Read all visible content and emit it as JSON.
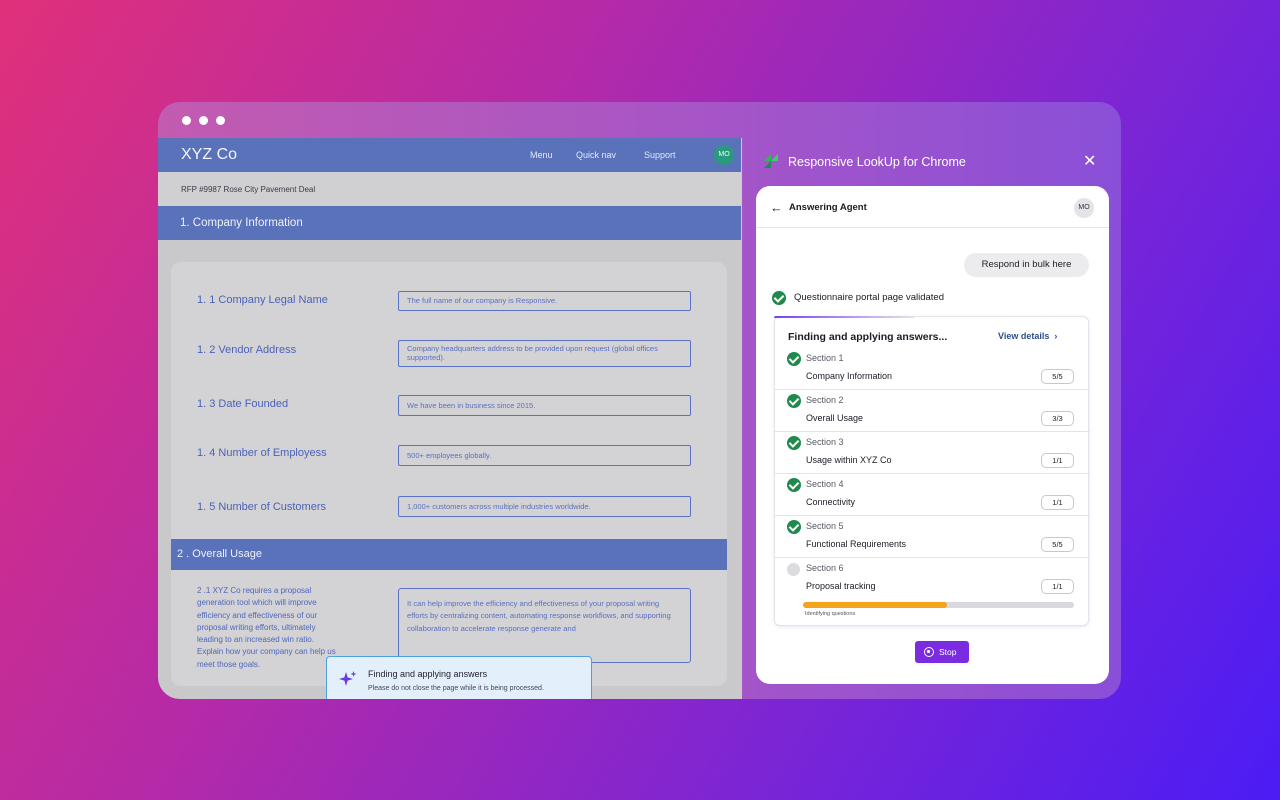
{
  "company": {
    "brand": "XYZ Co",
    "nav": [
      "Menu",
      "Quick nav",
      "Support"
    ],
    "avatar": "MO",
    "breadcrumb": "RFP #9987 Rose City Pavement Deal"
  },
  "section1": {
    "title": "1. Company Information",
    "fields": [
      {
        "label": "1. 1 Company Legal Name",
        "value": "The full name of our company is Responsive."
      },
      {
        "label": "1. 2 Vendor Address",
        "value": "Company headquarters address to be provided upon request (global offices supported)."
      },
      {
        "label": "1. 3 Date Founded",
        "value": "We have been in business since 2015."
      },
      {
        "label": "1. 4 Number of Employess",
        "value": "500+ employees globally."
      },
      {
        "label": "1. 5 Number of Customers",
        "value": "1,000+ customers across multiple industries worldwide."
      }
    ]
  },
  "section2": {
    "title": "2 . Overall Usage",
    "question": "2 .1 XYZ Co requires a proposal generation tool which will improve efficiency and effectiveness of our proposal writing efforts, ultimately leading to an increased win ratio. Explain how your company can help us meet those goals.",
    "answer": "It can help improve the efficiency and effectiveness of your proposal writing efforts by centralizing content, automating response workflows, and supporting collaboration to accelerate response generate and"
  },
  "toast": {
    "title": "Finding and applying answers",
    "subtitle": "Please do not close the page while it is being processed."
  },
  "extension": {
    "title": "Responsive LookUp for Chrome",
    "agent_title": "Answering Agent",
    "avatar": "MO",
    "bulk_label": "Respond in bulk here",
    "validated_text": "Questionnaire portal page validated",
    "progress_title": "Finding and applying answers...",
    "view_details": "View details",
    "sections": [
      {
        "name": "Section 1",
        "desc": "Company Information",
        "count": "5/5",
        "done": true
      },
      {
        "name": "Section 2",
        "desc": "Overall Usage",
        "count": "3/3",
        "done": true
      },
      {
        "name": "Section 3",
        "desc": "Usage within XYZ Co",
        "count": "1/1",
        "done": true
      },
      {
        "name": "Section 4",
        "desc": "Connectivity",
        "count": "1/1",
        "done": true
      },
      {
        "name": "Section 5",
        "desc": "Functional Requirements",
        "count": "5/5",
        "done": true
      },
      {
        "name": "Section 6",
        "desc": "Proposal tracking",
        "count": "1/1",
        "done": false
      }
    ],
    "progress_fraction": 0.53,
    "progress_label": "Identifying questions",
    "stop_label": "Stop"
  },
  "colors": {
    "accent": "#7b2be0",
    "success": "#1f8a4c",
    "progress": "#f2a51a",
    "nav_blue": "#5a72b9"
  }
}
